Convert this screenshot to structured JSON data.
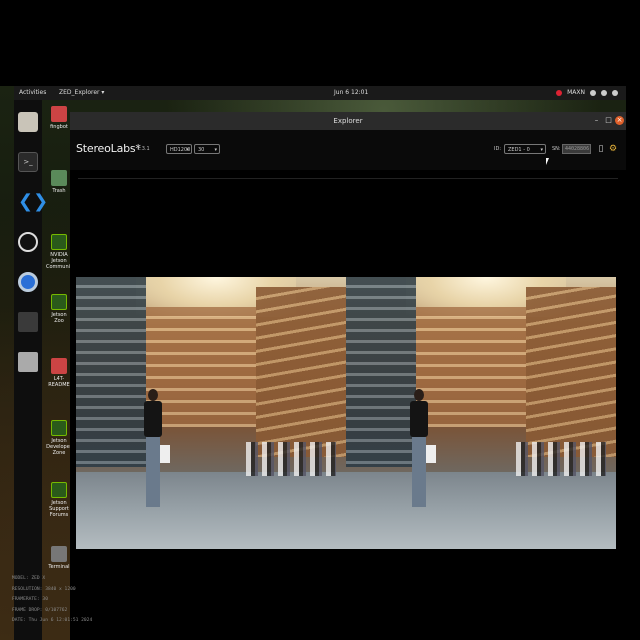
{
  "topbar": {
    "activities": "Activities",
    "app_menu": "ZED_Explorer ▾",
    "clock": "Jun 6 12:01",
    "tray_mode": "MAXN"
  },
  "desktop_icons": [
    {
      "label": "fingbot"
    },
    {
      "label": "Trash"
    },
    {
      "label": "NVIDIA Jetson Community"
    },
    {
      "label": "Jetson Zoo"
    },
    {
      "label": "L4T-README"
    },
    {
      "label": "Jetson Developer Zone"
    },
    {
      "label": "Jetson Support Forums"
    },
    {
      "label": "Terminal"
    }
  ],
  "window": {
    "title": "Explorer",
    "logo": "StereoLabs*",
    "version": "1.3.1",
    "resolution_select": "HD1200",
    "fps_select": "30",
    "id_label": "ID:",
    "id_select": "ZED1 - 0",
    "sn_label": "SN:",
    "sn_value": "44028806"
  },
  "info": {
    "model": "MODEL: ZED X",
    "resolution": "RESOLUTION: 3840 x 1200",
    "framerate": "FRAMERATE: 30",
    "frame_drop": "FRAME DROP: 0/107762",
    "date": "DATE: Thu Jun 6 12:01:51 2024"
  },
  "colors": {
    "accent": "#e0602a",
    "gear": "#e8b43a",
    "nvidia_green": "#76b900"
  }
}
